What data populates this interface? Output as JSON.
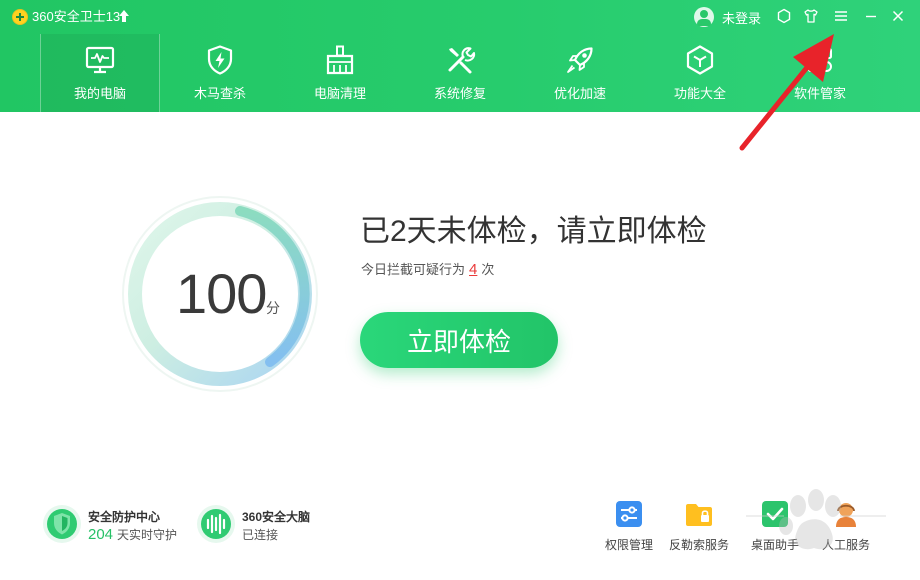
{
  "app": {
    "title": "360安全卫士13"
  },
  "user": {
    "login_label": "未登录"
  },
  "nav": [
    {
      "label": "我的电脑",
      "icon": "monitor-icon"
    },
    {
      "label": "木马查杀",
      "icon": "shield-bolt-icon"
    },
    {
      "label": "电脑清理",
      "icon": "broom-icon"
    },
    {
      "label": "系统修复",
      "icon": "tools-icon"
    },
    {
      "label": "优化加速",
      "icon": "rocket-icon"
    },
    {
      "label": "功能大全",
      "icon": "cube-icon"
    },
    {
      "label": "软件管家",
      "icon": "software-icon"
    }
  ],
  "status": {
    "score": "100",
    "score_unit": "分",
    "headline": "已2天未体检，请立即体检",
    "sub_prefix": "今日拦截可疑行为",
    "sub_count": "4",
    "sub_suffix": "次",
    "check_button": "立即体检"
  },
  "features": [
    {
      "title": "安全防护中心",
      "value": "204",
      "value_suffix": "天实时守护"
    },
    {
      "title": "360安全大脑",
      "subtitle": "已连接"
    }
  ],
  "tools": [
    {
      "label": "权限管理"
    },
    {
      "label": "反勒索服务"
    },
    {
      "label": "桌面助手"
    },
    {
      "label": "人工服务"
    }
  ],
  "colors": {
    "brand_green": "#27c96b",
    "accent_red": "#ea3a3a",
    "arrow_red": "#e8232a"
  }
}
